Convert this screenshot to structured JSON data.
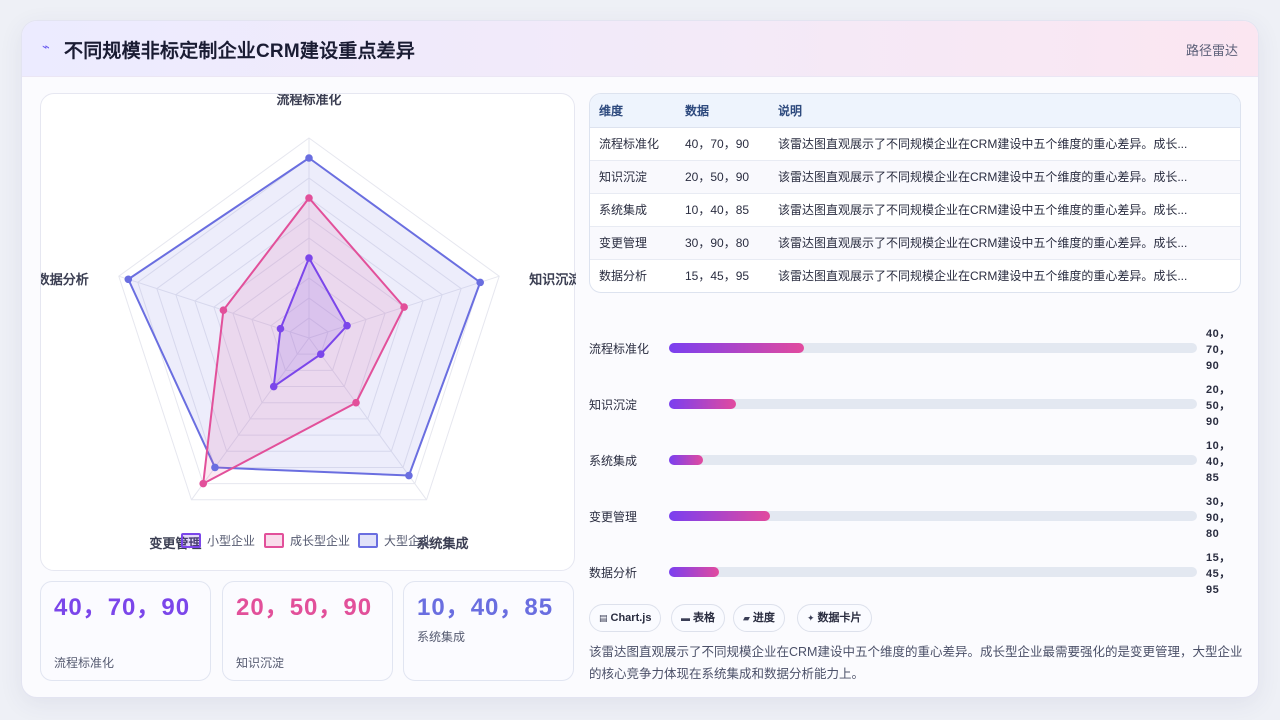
{
  "header": {
    "title": "不同规模非标定制企业CRM建设重点差异",
    "tag": "路径雷达",
    "icon": "pulse-icon"
  },
  "colors": {
    "small": "#7b46ea",
    "growth": "#e2509a",
    "large": "#6a6ee0"
  },
  "chart_data": {
    "type": "radar",
    "axes": [
      "流程标准化",
      "知识沉淀",
      "系统集成",
      "变更管理",
      "数据分析"
    ],
    "rmax": 100,
    "series": [
      {
        "name": "小型企业",
        "values": [
          40,
          20,
          10,
          30,
          15
        ]
      },
      {
        "name": "成长型企业",
        "values": [
          70,
          50,
          40,
          90,
          45
        ]
      },
      {
        "name": "大型企业",
        "values": [
          90,
          90,
          85,
          80,
          95
        ]
      }
    ],
    "legend_position": "bottom"
  },
  "stats": [
    {
      "value": "40，70，90",
      "label": "流程标准化"
    },
    {
      "value": "20，50，90",
      "label": "知识沉淀"
    },
    {
      "value": "10，40，85",
      "label": "系统集成"
    }
  ],
  "table": {
    "headers": [
      "维度",
      "数据",
      "说明"
    ],
    "rows": [
      [
        "流程标准化",
        "40，70，90",
        "该雷达图直观展示了不同规模企业在CRM建设中五个维度的重心差异。成长..."
      ],
      [
        "知识沉淀",
        "20，50，90",
        "该雷达图直观展示了不同规模企业在CRM建设中五个维度的重心差异。成长..."
      ],
      [
        "系统集成",
        "10，40，85",
        "该雷达图直观展示了不同规模企业在CRM建设中五个维度的重心差异。成长..."
      ],
      [
        "变更管理",
        "30，90，80",
        "该雷达图直观展示了不同规模企业在CRM建设中五个维度的重心差异。成长..."
      ],
      [
        "数据分析",
        "15，45，95",
        "该雷达图直观展示了不同规模企业在CRM建设中五个维度的重心差异。成长..."
      ]
    ]
  },
  "progress": [
    {
      "label": "流程标准化",
      "value": "40，70，90",
      "fill_pct": 25.5
    },
    {
      "label": "知识沉淀",
      "value": "20，50，90",
      "fill_pct": 12.7
    },
    {
      "label": "系统集成",
      "value": "10，40，85",
      "fill_pct": 6.4
    },
    {
      "label": "变更管理",
      "value": "30，90，80",
      "fill_pct": 19.1
    },
    {
      "label": "数据分析",
      "value": "15，45，95",
      "fill_pct": 9.5
    }
  ],
  "badges": [
    {
      "icon": "chart-icon",
      "glyph": "▤",
      "label": "Chart.js"
    },
    {
      "icon": "table-icon",
      "glyph": "▬",
      "label": "表格"
    },
    {
      "icon": "progress-icon",
      "glyph": "▰",
      "label": "进度"
    },
    {
      "icon": "sparkle-icon",
      "glyph": "✦",
      "label": "数据卡片"
    }
  ],
  "summary": "该雷达图直观展示了不同规模企业在CRM建设中五个维度的重心差异。成长型企业最需要强化的是变更管理，大型企业的核心竞争力体现在系统集成和数据分析能力上。"
}
